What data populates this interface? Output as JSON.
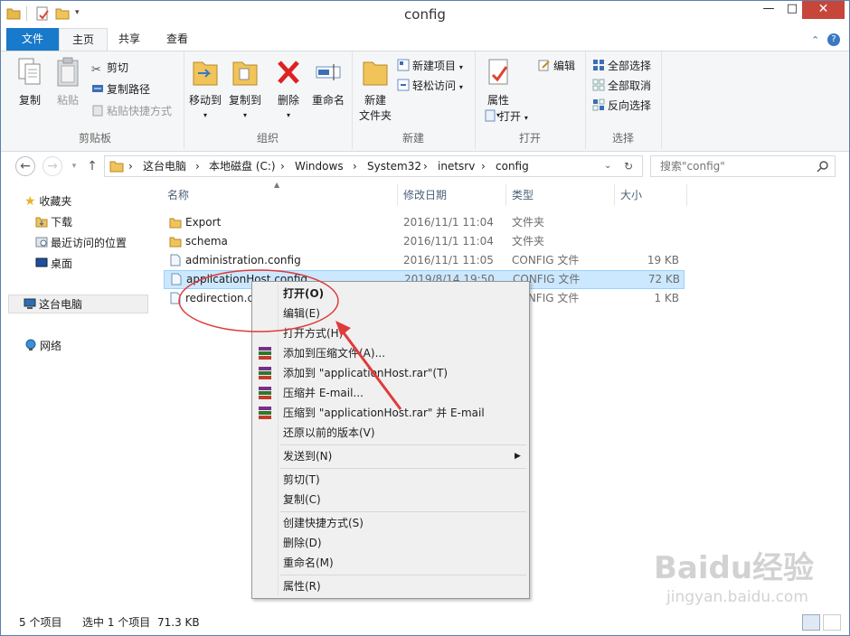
{
  "window": {
    "title": "config",
    "minimize": "—",
    "maximize": "□",
    "close": "✕"
  },
  "ribbon_tabs": [
    "文件",
    "主页",
    "共享",
    "查看"
  ],
  "ribbon": {
    "clipboard": {
      "copy": "复制",
      "paste": "粘贴",
      "cut": "剪切",
      "copy_path": "复制路径",
      "paste_shortcut": "粘贴快捷方式",
      "label": "剪贴板"
    },
    "organize": {
      "move_to": "移动到",
      "copy_to": "复制到",
      "delete": "删除",
      "rename": "重命名",
      "label": "组织"
    },
    "new": {
      "new_folder_1": "新建",
      "new_folder_2": "文件夹",
      "new_item": "新建项目",
      "easy_access": "轻松访问",
      "label": "新建"
    },
    "open": {
      "properties": "属性",
      "edit": "编辑",
      "open": "打开",
      "label": "打开"
    },
    "select": {
      "select_all": "全部选择",
      "select_none": "全部取消",
      "invert": "反向选择",
      "label": "选择"
    }
  },
  "address": {
    "crumbs": [
      "这台电脑",
      "本地磁盘 (C:)",
      "Windows",
      "System32",
      "inetsrv",
      "config"
    ],
    "sep": "›",
    "search_placeholder": "搜索\"config\""
  },
  "nav": {
    "favorites": "收藏夹",
    "downloads": "下载",
    "recent": "最近访问的位置",
    "desktop": "桌面",
    "this_pc": "这台电脑",
    "network": "网络"
  },
  "columns": {
    "name": "名称",
    "date": "修改日期",
    "type": "类型",
    "size": "大小"
  },
  "files": [
    {
      "name": "Export",
      "date": "2016/11/1 11:04",
      "type": "文件夹",
      "size": "",
      "kind": "folder-icon"
    },
    {
      "name": "schema",
      "date": "2016/11/1 11:04",
      "type": "文件夹",
      "size": "",
      "kind": "folder-icon"
    },
    {
      "name": "administration.config",
      "date": "2016/11/1 11:05",
      "type": "CONFIG 文件",
      "size": "19 KB",
      "kind": "file-icon"
    },
    {
      "name": "applicationHost.config",
      "date": "2019/8/14 19:50",
      "type": "CONFIG 文件",
      "size": "72 KB",
      "kind": "file-icon"
    },
    {
      "name": "redirection.c",
      "date": "",
      "type": "CONFIG 文件",
      "size": "1 KB",
      "kind": "file-icon"
    }
  ],
  "context_menu": {
    "open": "打开(O)",
    "edit": "编辑(E)",
    "open_with": "打开方式(H)",
    "add_archive": "添加到压缩文件(A)...",
    "add_rar": "添加到 \"applicationHost.rar\"(T)",
    "compress_email": "压缩并 E-mail...",
    "compress_rar_email": "压缩到 \"applicationHost.rar\" 并 E-mail",
    "restore": "还原以前的版本(V)",
    "send_to": "发送到(N)",
    "cut": "剪切(T)",
    "copy": "复制(C)",
    "create_shortcut": "创建快捷方式(S)",
    "delete": "删除(D)",
    "rename": "重命名(M)",
    "properties": "属性(R)"
  },
  "status": {
    "count": "5 个项目",
    "selected": "选中 1 个项目",
    "size": "71.3 KB"
  },
  "watermark": {
    "logo": "Baidu经验",
    "url": "jingyan.baidu.com"
  },
  "colors": {
    "file_tab": "#1979ca",
    "selection": "#cce8ff",
    "annotation": "#e03a3a"
  }
}
